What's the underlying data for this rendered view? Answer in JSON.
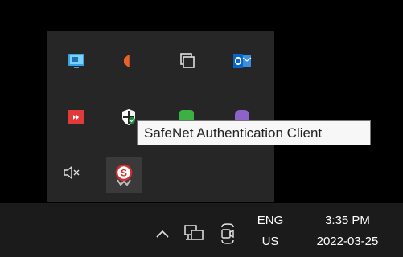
{
  "tray_overflow": {
    "icons": [
      {
        "name": "remote-desktop-icon"
      },
      {
        "name": "speaker-icon"
      },
      {
        "name": "copy-windows-icon"
      },
      {
        "name": "outlook-icon"
      },
      {
        "name": "red-app-icon"
      },
      {
        "name": "windows-security-icon"
      },
      {
        "name": "green-app-icon"
      },
      {
        "name": "viber-icon"
      },
      {
        "name": "volume-muted-icon"
      },
      {
        "name": "safenet-icon"
      }
    ]
  },
  "tooltip": {
    "text": "SafeNet Authentication Client"
  },
  "taskbar": {
    "language": {
      "top": "ENG",
      "bottom": "US"
    },
    "clock": {
      "time": "3:35 PM",
      "date": "2022-03-25"
    }
  },
  "colors": {
    "taskbar_bg": "#1b1b1b",
    "tray_bg": "#262626",
    "tooltip_bg": "#f7f7f7",
    "safenet_red": "#d32f2f",
    "outlook_blue": "#0a64c8",
    "speaker_orange": "#e8622c"
  }
}
